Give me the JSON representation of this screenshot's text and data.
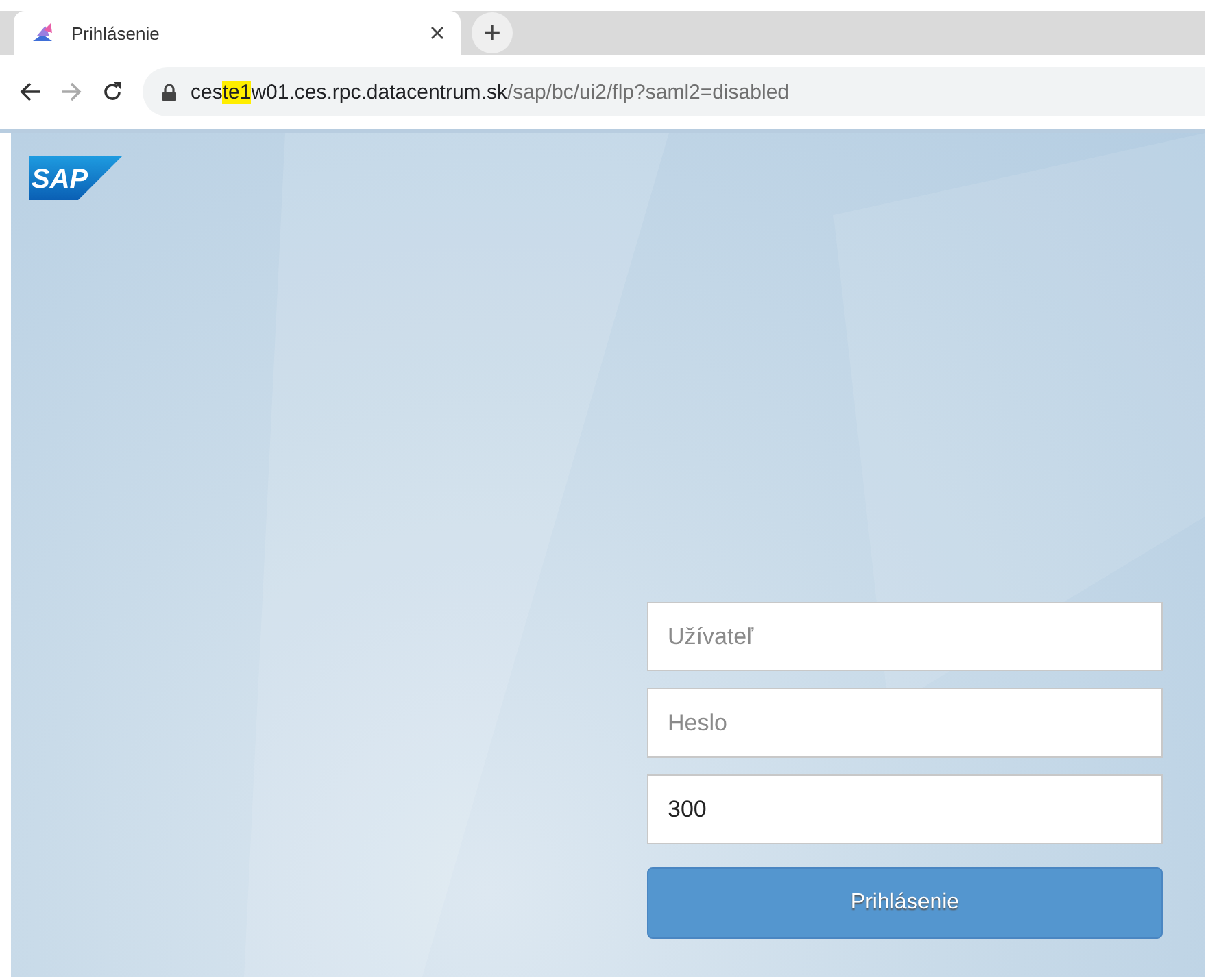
{
  "browser": {
    "tab": {
      "title": "Prihlásenie",
      "selected": true
    },
    "new_tab": "+",
    "address_parts": [
      {
        "text": "ces",
        "highlighted": false,
        "dimmed": false
      },
      {
        "text": "te1",
        "highlighted": true,
        "dimmed": false
      },
      {
        "text": "w01.ces.rpc.datacentrum.sk",
        "highlighted": false,
        "dimmed": false
      },
      {
        "text": "/sap/bc/ui2/flp?saml2=disabled",
        "highlighted": false,
        "dimmed": true
      }
    ]
  },
  "page": {
    "logo_text": "SAP",
    "fields": [
      {
        "kind": "text",
        "placeholder": "Užívateľ"
      },
      {
        "kind": "password",
        "placeholder": "Heslo"
      },
      {
        "kind": "text",
        "value": "300"
      }
    ],
    "login_button": "Prihlásenie"
  }
}
